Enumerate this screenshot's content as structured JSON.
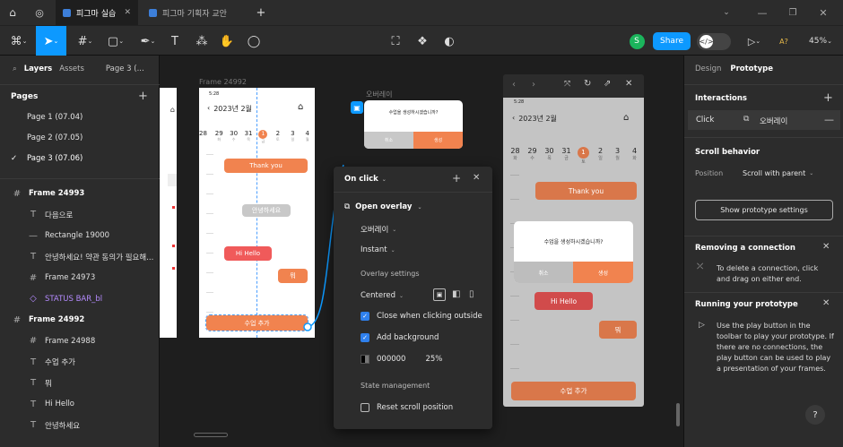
{
  "tabs": {
    "home": "⌂",
    "globe": "◎",
    "tab1": "피그마 실습",
    "tab2": "피그마 기획자 교안",
    "plus": "+"
  },
  "toolbar": {
    "share": "Share",
    "avatar": "S",
    "zoom": "45%",
    "a_label": "A?"
  },
  "left": {
    "tab_layers": "Layers",
    "tab_assets": "Assets",
    "page_select": "Page 3 (...",
    "pages_title": "Pages",
    "pages": [
      "Page 1 (07.04)",
      "Page 2 (07.05)",
      "Page 3 (07.06)"
    ],
    "layers": [
      {
        "name": "Frame 24993",
        "icon": "#",
        "bold": true
      },
      {
        "name": "다음으로",
        "icon": "T"
      },
      {
        "name": "Rectangle 19000",
        "icon": "—"
      },
      {
        "name": "안녕하세요! 약관 동의가 필요해...",
        "icon": "T"
      },
      {
        "name": "Frame 24973",
        "icon": "#"
      },
      {
        "name": "STATUS BAR_bl",
        "icon": "◇",
        "purple": true
      },
      {
        "name": "Frame 24992",
        "icon": "#",
        "bold": true
      },
      {
        "name": "Frame 24988",
        "icon": "#"
      },
      {
        "name": "수업 추가",
        "icon": "T"
      },
      {
        "name": "뭐",
        "icon": "T"
      },
      {
        "name": "Hi Hello",
        "icon": "T"
      },
      {
        "name": "안녕하세요",
        "icon": "T"
      }
    ]
  },
  "canvas": {
    "frame_label": "Frame 24992",
    "overlay_label": "오버레이",
    "phone": {
      "time": "5:28",
      "month": "2023년 2월",
      "dates": [
        "29",
        "30",
        "31",
        "1",
        "2",
        "3",
        "4"
      ],
      "days": [
        "화",
        "수",
        "목",
        "금",
        "토",
        "일",
        "월"
      ],
      "first_date": "28",
      "thank": "Thank you",
      "hello_ko": "안녕하세요",
      "hi": "Hi Hello",
      "mwo": "뭐",
      "add": "수업 추가"
    },
    "dialog": {
      "text": "수업을 생성하시겠습니까?",
      "cancel": "취소",
      "ok": "생성"
    },
    "popup": {
      "title": "On click",
      "action": "Open overlay",
      "dest": "오버레이",
      "anim": "Instant",
      "overlay_settings": "Overlay settings",
      "position": "Centered",
      "close_outside": "Close when clicking outside",
      "add_bg": "Add background",
      "color": "000000",
      "opacity": "25%",
      "state_mgmt": "State management",
      "reset_scroll": "Reset scroll position"
    },
    "preview": {
      "time": "5:28",
      "month": "2023년 2월",
      "dates": [
        "28",
        "29",
        "30",
        "31",
        "1",
        "2",
        "3",
        "4"
      ],
      "days": [
        "화",
        "수",
        "목",
        "금",
        "토",
        "일",
        "월",
        "화"
      ],
      "thank": "Thank you",
      "dialog_text": "수업을 생성하시겠습니까?",
      "cancel": "취소",
      "ok": "생성",
      "hi": "Hi Hello",
      "mwo": "뭐",
      "add": "수업 추가"
    }
  },
  "right": {
    "tab_design": "Design",
    "tab_prototype": "Prototype",
    "interactions": "Interactions",
    "click": "Click",
    "overlay": "오버레이",
    "scroll_behavior": "Scroll behavior",
    "position_label": "Position",
    "position_value": "Scroll with parent",
    "show_settings": "Show prototype settings",
    "removing_title": "Removing a connection",
    "removing_text": "To delete a connection, click and drag on either end.",
    "running_title": "Running your prototype",
    "running_text": "Use the play button in the toolbar to play your prototype. If there are no connections, the play button can be used to play a presentation of your frames.",
    "help": "?"
  },
  "colors": {
    "accent": "#0d99ff",
    "orange": "#f1834f",
    "red": "#f05a5a"
  }
}
